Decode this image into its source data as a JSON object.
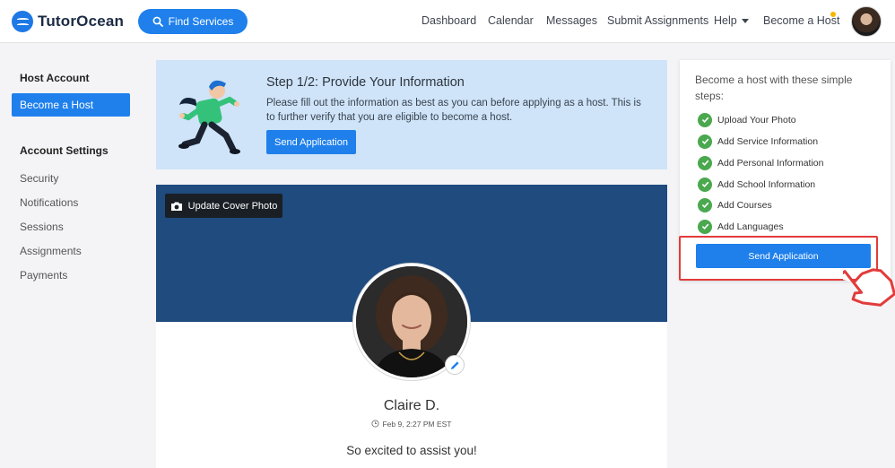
{
  "brand": {
    "name": "TutorOcean",
    "accent": "#1f80ec"
  },
  "header": {
    "find_services": "Find Services",
    "nav": [
      "Dashboard",
      "Calendar",
      "Messages",
      "Submit Assignments",
      "Help",
      "Become a Host"
    ]
  },
  "sidebar": {
    "host_heading": "Host Account",
    "host_active": "Become a Host",
    "settings_heading": "Account Settings",
    "items": [
      "Security",
      "Notifications",
      "Sessions",
      "Assignments",
      "Payments"
    ]
  },
  "banner": {
    "title": "Step 1/2: Provide Your Information",
    "description": "Please fill out the information as best as you can before applying as a host. This is to further verify that you are eligible to become a host.",
    "button": "Send Application"
  },
  "profile": {
    "cover_button": "Update Cover Photo",
    "name": "Claire D.",
    "timestamp": "Feb 9, 2:27 PM EST",
    "status": "So excited to assist you!"
  },
  "steps": {
    "intro": "Become a host with these simple steps:",
    "items": [
      "Upload Your Photo",
      "Add Service Information",
      "Add Personal Information",
      "Add School Information",
      "Add Courses",
      "Add Languages"
    ],
    "button": "Send Application",
    "check_color": "#4aa84e",
    "highlight_color": "#e23b3b"
  },
  "icons": [
    "logo-waves-icon",
    "search-icon",
    "caret-down-icon",
    "camera-icon",
    "pencil-icon",
    "clock-icon",
    "check-icon",
    "pointer-hand-icon"
  ]
}
